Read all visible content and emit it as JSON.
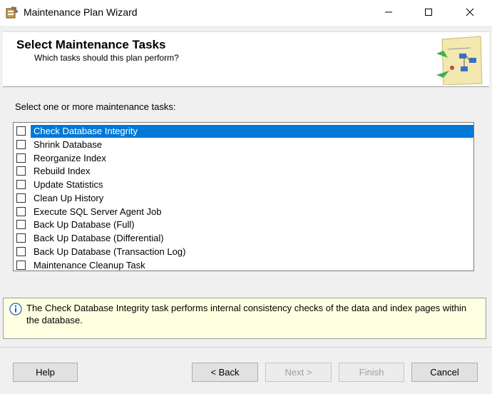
{
  "window": {
    "title": "Maintenance Plan Wizard",
    "minimize_icon": "minimize-icon",
    "maximize_icon": "maximize-icon",
    "close_icon": "close-icon"
  },
  "header": {
    "title": "Select Maintenance Tasks",
    "subtitle": "Which tasks should this plan perform?",
    "graphic": "wizard-graphic"
  },
  "instruction": "Select one or more maintenance tasks:",
  "tasks": [
    {
      "label": "Check Database Integrity",
      "checked": false,
      "selected": true
    },
    {
      "label": "Shrink Database",
      "checked": false,
      "selected": false
    },
    {
      "label": "Reorganize Index",
      "checked": false,
      "selected": false
    },
    {
      "label": "Rebuild Index",
      "checked": false,
      "selected": false
    },
    {
      "label": "Update Statistics",
      "checked": false,
      "selected": false
    },
    {
      "label": "Clean Up History",
      "checked": false,
      "selected": false
    },
    {
      "label": "Execute SQL Server Agent Job",
      "checked": false,
      "selected": false
    },
    {
      "label": "Back Up Database (Full)",
      "checked": false,
      "selected": false
    },
    {
      "label": "Back Up Database (Differential)",
      "checked": false,
      "selected": false
    },
    {
      "label": "Back Up Database (Transaction Log)",
      "checked": false,
      "selected": false
    },
    {
      "label": "Maintenance Cleanup Task",
      "checked": false,
      "selected": false
    }
  ],
  "description": "The Check Database Integrity task performs internal consistency checks of the data and index pages within the database.",
  "buttons": {
    "help": "Help",
    "back": "< Back",
    "next": "Next >",
    "finish": "Finish",
    "cancel": "Cancel"
  },
  "colors": {
    "selection": "#0078d7",
    "description_bg": "#ffffe1",
    "window_bg": "#f0f0f0"
  }
}
